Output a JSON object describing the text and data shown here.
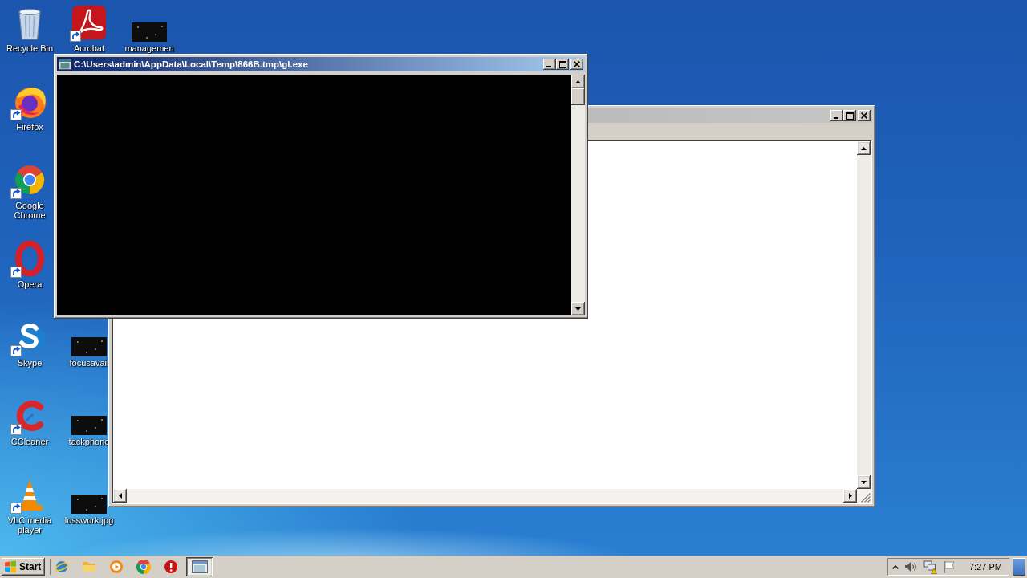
{
  "desktop_icons": [
    {
      "label": "Recycle Bin",
      "kind": "recycle-bin",
      "shortcut": false
    },
    {
      "label": "Acrobat",
      "kind": "acrobat",
      "shortcut": true
    },
    {
      "label": "managemen",
      "kind": "image-file",
      "shortcut": false
    },
    {
      "label": "Firefox",
      "kind": "firefox",
      "shortcut": true
    },
    {
      "label": "Google Chrome",
      "kind": "chrome",
      "shortcut": true
    },
    {
      "label": "Opera",
      "kind": "opera",
      "shortcut": true
    },
    {
      "label": "Skype",
      "kind": "skype",
      "shortcut": true
    },
    {
      "label": "focusavail",
      "kind": "image-file",
      "shortcut": false
    },
    {
      "label": "CCleaner",
      "kind": "ccleaner",
      "shortcut": true
    },
    {
      "label": "tackphone",
      "kind": "image-file",
      "shortcut": false
    },
    {
      "label": "VLC media player",
      "kind": "vlc",
      "shortcut": true
    },
    {
      "label": "losswork.jpg",
      "kind": "image-file",
      "shortcut": false
    }
  ],
  "console_window": {
    "title": "C:\\Users\\admin\\AppData\\Local\\Temp\\866B.tmp\\gl.exe",
    "active": true
  },
  "background_window": {
    "active": false
  },
  "taskbar": {
    "start_label": "Start",
    "task_buttons": [
      {
        "selected": true
      }
    ],
    "clock": "7:27 PM"
  }
}
